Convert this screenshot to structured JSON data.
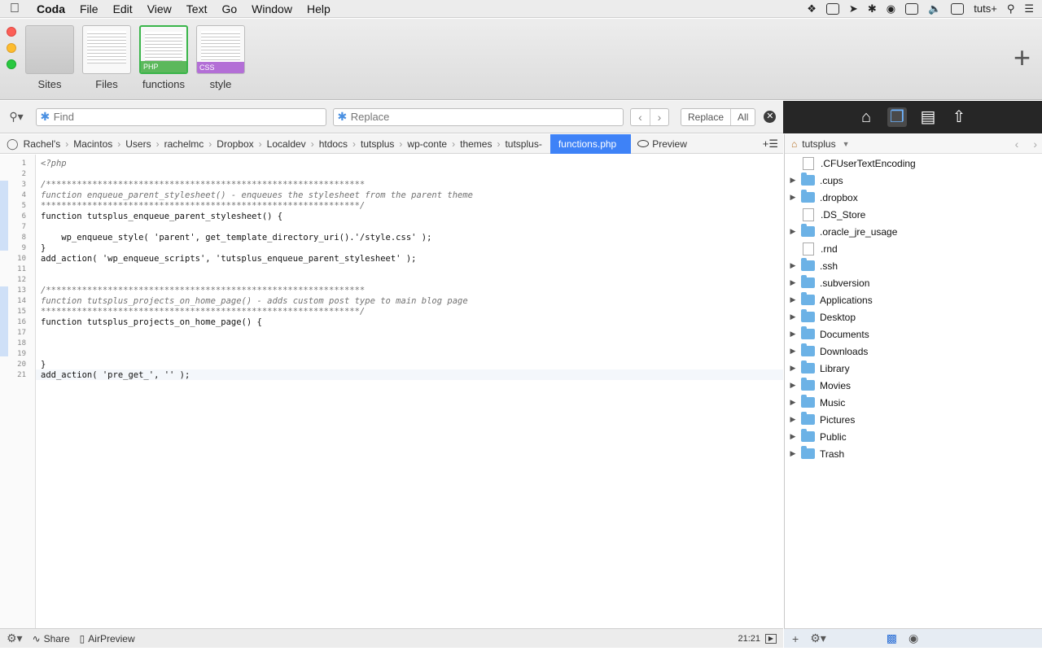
{
  "menubar": {
    "app": "Coda",
    "items": [
      "File",
      "Edit",
      "View",
      "Text",
      "Go",
      "Window",
      "Help"
    ],
    "user": "tuts+"
  },
  "tabs": [
    {
      "label": "Sites"
    },
    {
      "label": "Files"
    },
    {
      "label": "functions",
      "tag": "PHP"
    },
    {
      "label": "style",
      "tag": "CSS"
    }
  ],
  "find": {
    "placeholder": "Find"
  },
  "replace": {
    "placeholder": "Replace",
    "replace_label": "Replace",
    "all_label": "All"
  },
  "breadcrumb": [
    "Rachel's",
    "Macintos",
    "Users",
    "rachelmc",
    "Dropbox",
    "Localdev",
    "htdocs",
    "tutsplus",
    "wp-conte",
    "themes",
    "tutsplus-"
  ],
  "current_file": "functions.php",
  "preview_label": "Preview",
  "code": [
    "<?php",
    "",
    "/**************************************************************",
    "function enqueue_parent_stylesheet() - enqueues the stylesheet from the parent theme",
    "**************************************************************/",
    "function tutsplus_enqueue_parent_stylesheet() {",
    "",
    "    wp_enqueue_style( 'parent', get_template_directory_uri().'/style.css' );",
    "}",
    "add_action( 'wp_enqueue_scripts', 'tutsplus_enqueue_parent_stylesheet' );",
    "",
    "",
    "/**************************************************************",
    "function tutsplus_projects_on_home_page() - adds custom post type to main blog page",
    "**************************************************************/",
    "function tutsplus_projects_on_home_page() {",
    "",
    "",
    "",
    "}",
    "add_action( 'pre_get_', '' );"
  ],
  "line_numbers": [
    "1",
    "2",
    "3",
    "4",
    "5",
    "6",
    "7",
    "8",
    "9",
    "10",
    "11",
    "12",
    "13",
    "14",
    "15",
    "16",
    "17",
    "18",
    "19",
    "20",
    "21"
  ],
  "status": {
    "share": "Share",
    "airpreview": "AirPreview",
    "cursor": "21:21"
  },
  "sidebar": {
    "site": "tutsplus",
    "files": [
      {
        "name": ".CFUserTextEncoding",
        "type": "file"
      },
      {
        "name": ".cups",
        "type": "folder"
      },
      {
        "name": ".dropbox",
        "type": "folder"
      },
      {
        "name": ".DS_Store",
        "type": "file"
      },
      {
        "name": ".oracle_jre_usage",
        "type": "folder"
      },
      {
        "name": ".rnd",
        "type": "file"
      },
      {
        "name": ".ssh",
        "type": "folder"
      },
      {
        "name": ".subversion",
        "type": "folder"
      },
      {
        "name": "Applications",
        "type": "folder"
      },
      {
        "name": "Desktop",
        "type": "folder"
      },
      {
        "name": "Documents",
        "type": "folder"
      },
      {
        "name": "Downloads",
        "type": "folder"
      },
      {
        "name": "Library",
        "type": "folder"
      },
      {
        "name": "Movies",
        "type": "folder"
      },
      {
        "name": "Music",
        "type": "folder"
      },
      {
        "name": "Pictures",
        "type": "folder"
      },
      {
        "name": "Public",
        "type": "folder"
      },
      {
        "name": "Trash",
        "type": "folder"
      }
    ]
  }
}
